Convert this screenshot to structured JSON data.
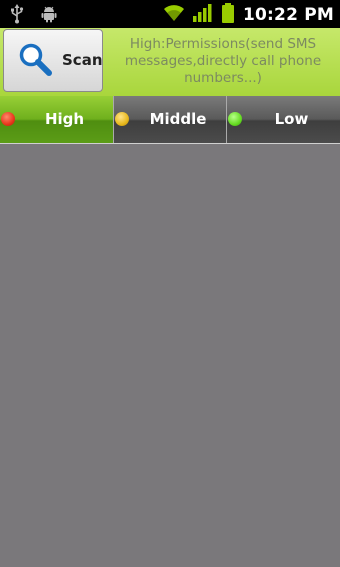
{
  "status_bar": {
    "time": "10:22 PM",
    "icons": [
      "usb-icon",
      "android-debug-icon",
      "wifi-icon",
      "signal-icon",
      "battery-icon"
    ],
    "icon_color": "#99cc00"
  },
  "header": {
    "scan_label": "Scan",
    "info_text": "High:Permissions(send SMS messages,directly call phone numbers...)",
    "background_color": "#b4dc4a"
  },
  "tabs": [
    {
      "label": "High",
      "dot_color": "#e8361c",
      "active": true
    },
    {
      "label": "Middle",
      "dot_color": "#e8b81c",
      "active": false
    },
    {
      "label": "Low",
      "dot_color": "#66dd22",
      "active": false
    }
  ]
}
